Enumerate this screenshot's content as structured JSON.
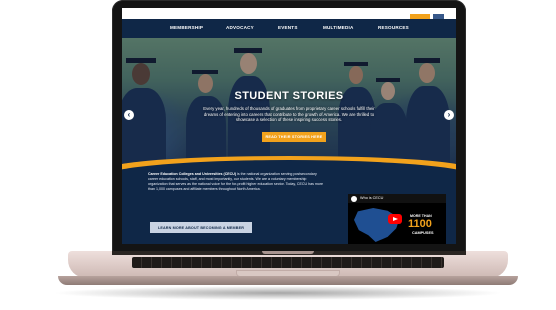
{
  "nav": {
    "items": [
      "MEMBERSHIP",
      "ADVOCACY",
      "EVENTS",
      "MULTIMEDIA",
      "RESOURCES"
    ]
  },
  "hero": {
    "title": "STUDENT STORIES",
    "text": "Every year, hundreds of thousands of graduates from proprietary career schools fulfill their dreams of entering into careers that contribute to the growth of America. We are thrilled to showcase a selection of these inspiring success stories.",
    "button": "READ THEIR STORIES HERE",
    "prev": "‹",
    "next": "›"
  },
  "about": {
    "org": "Career Education Colleges and Universities (CECU)",
    "text": " is the national organization serving postsecondary career education schools, staff, and most importantly, our students. We are a voluntary membership organization that serves as the national voice for the for-profit higher education sector. Today, CECU has more than 1,000 campuses and affiliate members throughout North America.",
    "button": "LEARN MORE ABOUT BECOMING A MEMBER"
  },
  "video": {
    "title": "Who is CECU",
    "more_than": "MORE THAN",
    "number": "1100",
    "campuses": "CAMPUSES"
  },
  "colors": {
    "navy": "#0f2747",
    "orange": "#f2a21c",
    "youtube_red": "#ff0000"
  }
}
